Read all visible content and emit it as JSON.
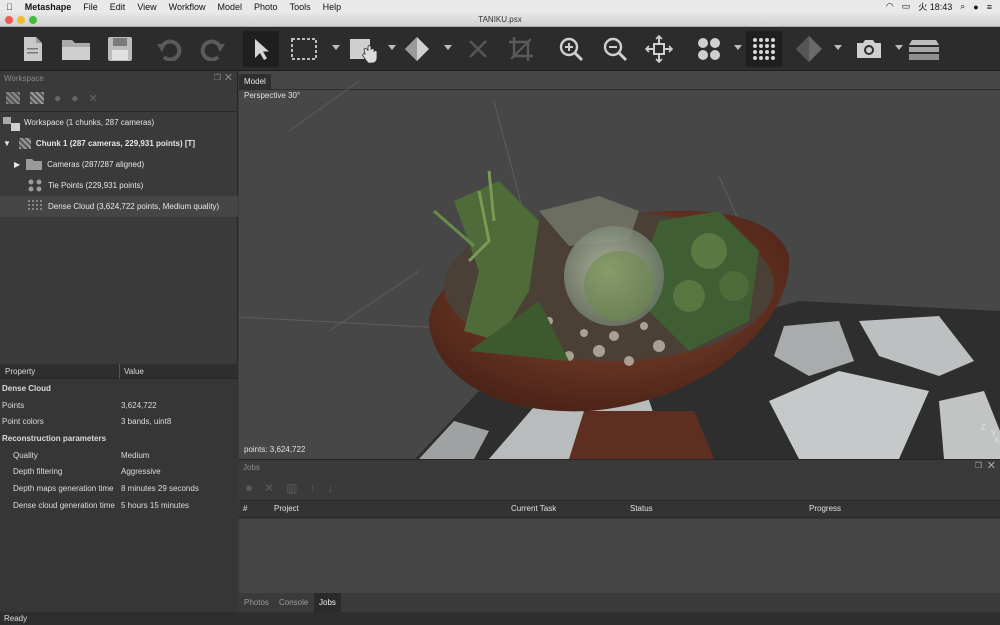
{
  "menubar": {
    "app": "Metashape",
    "items": [
      "File",
      "Edit",
      "View",
      "Workflow",
      "Model",
      "Photo",
      "Tools",
      "Help"
    ],
    "clock": "火 18:43"
  },
  "window": {
    "title": "TANIKU.psx"
  },
  "toolbar": {
    "buttons": [
      "new-icon",
      "open-icon",
      "save-icon",
      "undo-icon",
      "redo-icon",
      "navigation-icon",
      "rectangle-selection-icon",
      "move-region-icon",
      "rotate-region-icon",
      "delete-icon",
      "crop-icon",
      "zoom-in-icon",
      "zoom-out-icon",
      "reset-view-icon",
      "show-cameras-icon",
      "show-points-icon",
      "show-model-icon",
      "capture-view-icon",
      "layers-icon"
    ]
  },
  "workspace": {
    "title": "Workspace",
    "root": "Workspace (1 chunks, 287 cameras)",
    "chunk": "Chunk 1 (287 cameras, 229,931 points) [T]",
    "cameras": "Cameras (287/287 aligned)",
    "tie_points": "Tie Points (229,931 points)",
    "dense_cloud": "Dense Cloud (3,624,722 points, Medium quality)"
  },
  "properties": {
    "col_property": "Property",
    "col_value": "Value",
    "section1": "Dense Cloud",
    "rows1": [
      {
        "k": "Points",
        "v": "3,624,722"
      },
      {
        "k": "Point colors",
        "v": "3 bands, uint8"
      }
    ],
    "section2": "Reconstruction parameters",
    "rows2": [
      {
        "k": "Quality",
        "v": "Medium"
      },
      {
        "k": "Depth filtering",
        "v": "Aggressive"
      },
      {
        "k": "Depth maps generation time",
        "v": "8 minutes 29 seconds"
      },
      {
        "k": "Dense cloud generation time",
        "v": "5 hours 15 minutes"
      }
    ]
  },
  "viewport": {
    "tab": "Model",
    "projection": "Perspective 30°",
    "points": "points: 3,624,722",
    "axes": [
      "Z",
      "Y",
      "X"
    ]
  },
  "jobs": {
    "title": "Jobs",
    "columns": [
      "#",
      "Project",
      "Current Task",
      "Status",
      "Progress"
    ],
    "tabs": [
      "Photos",
      "Console",
      "Jobs"
    ]
  },
  "status": "Ready"
}
